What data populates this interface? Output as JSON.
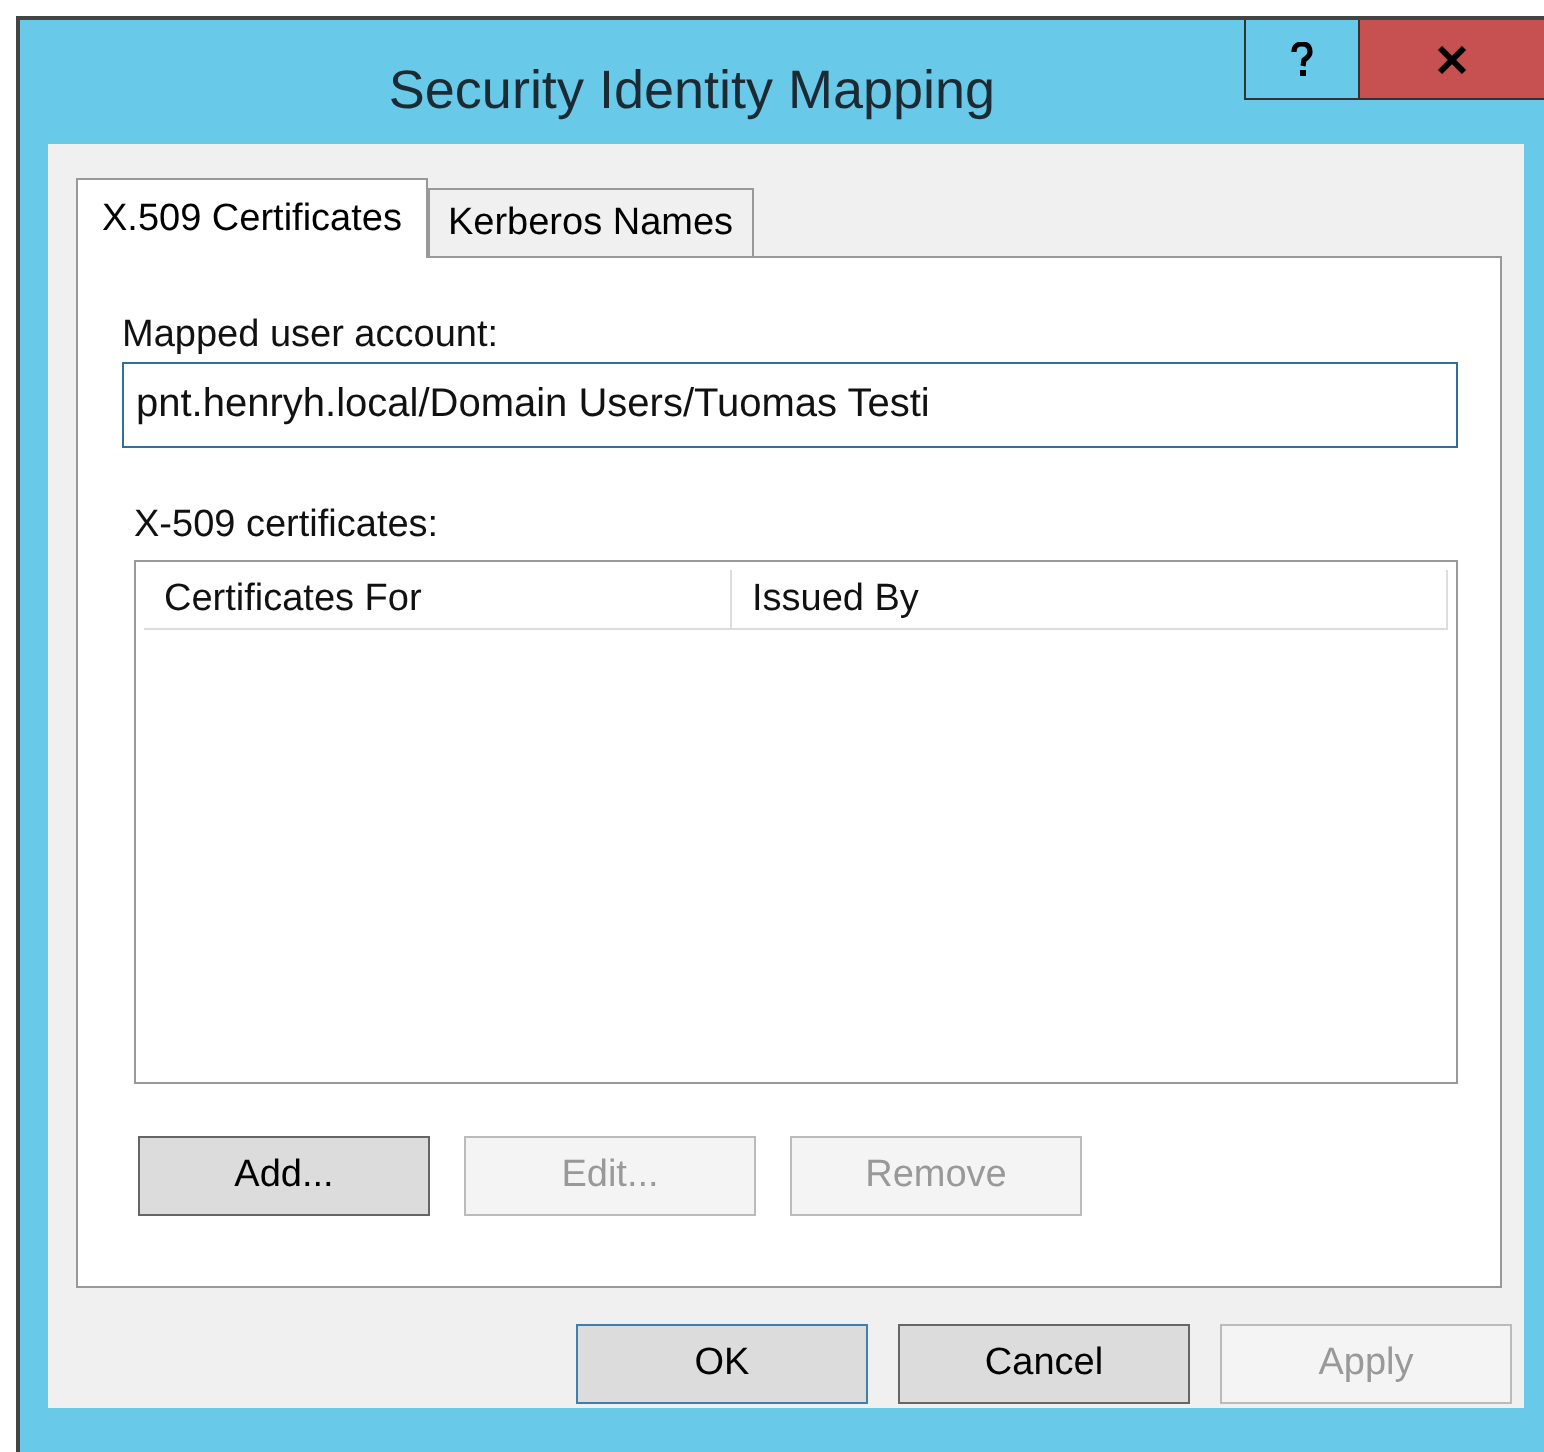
{
  "window": {
    "title": "Security Identity Mapping"
  },
  "tabs": [
    {
      "label": "X.509 Certificates",
      "selected": true
    },
    {
      "label": "Kerberos Names",
      "selected": false
    }
  ],
  "mapped_account": {
    "label": "Mapped user account:",
    "value": "pnt.henryh.local/Domain Users/Tuomas Testi"
  },
  "certificates": {
    "label": "X-509 certificates:",
    "columns": [
      "Certificates For",
      "Issued By"
    ]
  },
  "list_buttons": [
    {
      "label": "Add...",
      "disabled": false,
      "default": false
    },
    {
      "label": "Edit...",
      "disabled": true,
      "default": false
    },
    {
      "label": "Remove",
      "disabled": true,
      "default": false
    }
  ],
  "dialog_buttons": [
    {
      "label": "OK",
      "disabled": false,
      "default": true
    },
    {
      "label": "Cancel",
      "disabled": false,
      "default": false
    },
    {
      "label": "Apply",
      "disabled": true,
      "default": false
    }
  ]
}
